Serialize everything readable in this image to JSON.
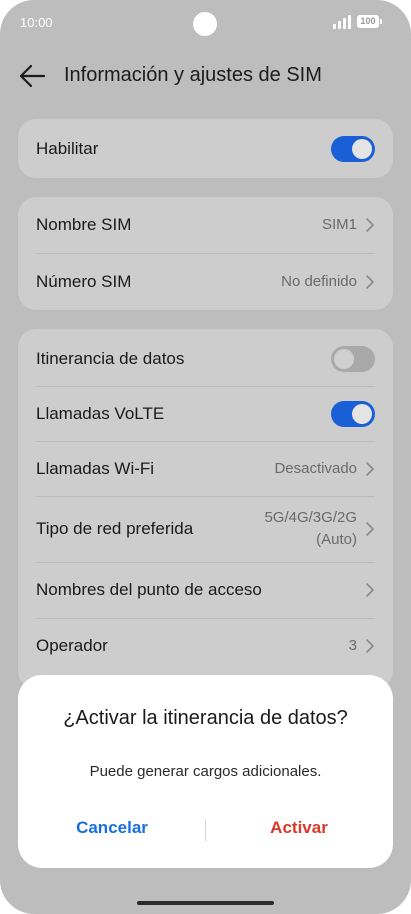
{
  "status_bar": {
    "time": "10:00",
    "battery": "100"
  },
  "header": {
    "title": "Información y ajustes de SIM"
  },
  "enable": {
    "label": "Habilitar",
    "state": "on"
  },
  "sim_info": {
    "name_label": "Nombre SIM",
    "name_value": "SIM1",
    "number_label": "Número SIM",
    "number_value": "No definido"
  },
  "settings": {
    "roaming_label": "Itinerancia de datos",
    "roaming_state": "off",
    "volte_label": "Llamadas VoLTE",
    "volte_state": "on",
    "wifi_calls_label": "Llamadas Wi-Fi",
    "wifi_calls_value": "Desactivado",
    "network_label": "Tipo de red preferida",
    "network_value_line1": "5G/4G/3G/2G",
    "network_value_line2": "(Auto)",
    "apn_label": "Nombres del punto de acceso",
    "operator_label": "Operador",
    "operator_value": "3"
  },
  "dialog": {
    "title": "¿Activar la itinerancia de datos?",
    "message": "Puede generar cargos adicionales.",
    "cancel": "Cancelar",
    "confirm": "Activar"
  },
  "colors": {
    "accent": "#1a5fd6",
    "cancel": "#1a6fe0",
    "confirm": "#d9392c",
    "overlay_bg": "#bdbdbd",
    "card_bg": "#cdcdcd"
  }
}
